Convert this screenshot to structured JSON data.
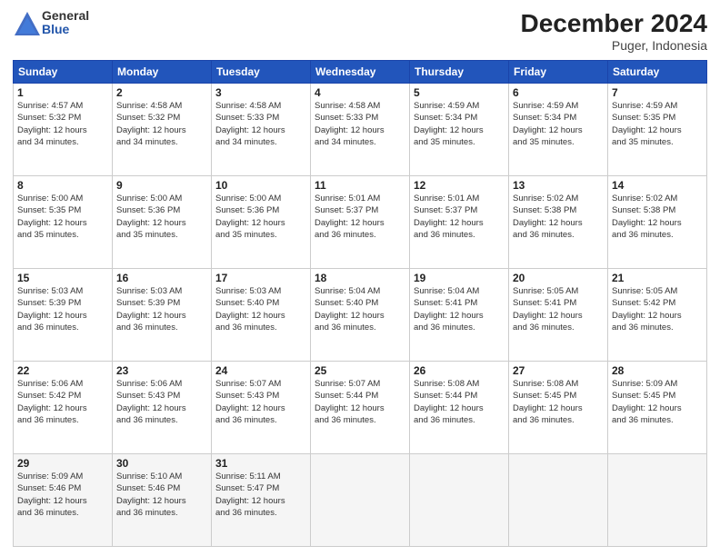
{
  "header": {
    "logo": {
      "general": "General",
      "blue": "Blue"
    },
    "title": "December 2024",
    "location": "Puger, Indonesia"
  },
  "weekdays": [
    "Sunday",
    "Monday",
    "Tuesday",
    "Wednesday",
    "Thursday",
    "Friday",
    "Saturday"
  ],
  "weeks": [
    [
      {
        "day": 1,
        "info": "Sunrise: 4:57 AM\nSunset: 5:32 PM\nDaylight: 12 hours\nand 34 minutes."
      },
      {
        "day": 2,
        "info": "Sunrise: 4:58 AM\nSunset: 5:32 PM\nDaylight: 12 hours\nand 34 minutes."
      },
      {
        "day": 3,
        "info": "Sunrise: 4:58 AM\nSunset: 5:33 PM\nDaylight: 12 hours\nand 34 minutes."
      },
      {
        "day": 4,
        "info": "Sunrise: 4:58 AM\nSunset: 5:33 PM\nDaylight: 12 hours\nand 34 minutes."
      },
      {
        "day": 5,
        "info": "Sunrise: 4:59 AM\nSunset: 5:34 PM\nDaylight: 12 hours\nand 35 minutes."
      },
      {
        "day": 6,
        "info": "Sunrise: 4:59 AM\nSunset: 5:34 PM\nDaylight: 12 hours\nand 35 minutes."
      },
      {
        "day": 7,
        "info": "Sunrise: 4:59 AM\nSunset: 5:35 PM\nDaylight: 12 hours\nand 35 minutes."
      }
    ],
    [
      {
        "day": 8,
        "info": "Sunrise: 5:00 AM\nSunset: 5:35 PM\nDaylight: 12 hours\nand 35 minutes."
      },
      {
        "day": 9,
        "info": "Sunrise: 5:00 AM\nSunset: 5:36 PM\nDaylight: 12 hours\nand 35 minutes."
      },
      {
        "day": 10,
        "info": "Sunrise: 5:00 AM\nSunset: 5:36 PM\nDaylight: 12 hours\nand 35 minutes."
      },
      {
        "day": 11,
        "info": "Sunrise: 5:01 AM\nSunset: 5:37 PM\nDaylight: 12 hours\nand 36 minutes."
      },
      {
        "day": 12,
        "info": "Sunrise: 5:01 AM\nSunset: 5:37 PM\nDaylight: 12 hours\nand 36 minutes."
      },
      {
        "day": 13,
        "info": "Sunrise: 5:02 AM\nSunset: 5:38 PM\nDaylight: 12 hours\nand 36 minutes."
      },
      {
        "day": 14,
        "info": "Sunrise: 5:02 AM\nSunset: 5:38 PM\nDaylight: 12 hours\nand 36 minutes."
      }
    ],
    [
      {
        "day": 15,
        "info": "Sunrise: 5:03 AM\nSunset: 5:39 PM\nDaylight: 12 hours\nand 36 minutes."
      },
      {
        "day": 16,
        "info": "Sunrise: 5:03 AM\nSunset: 5:39 PM\nDaylight: 12 hours\nand 36 minutes."
      },
      {
        "day": 17,
        "info": "Sunrise: 5:03 AM\nSunset: 5:40 PM\nDaylight: 12 hours\nand 36 minutes."
      },
      {
        "day": 18,
        "info": "Sunrise: 5:04 AM\nSunset: 5:40 PM\nDaylight: 12 hours\nand 36 minutes."
      },
      {
        "day": 19,
        "info": "Sunrise: 5:04 AM\nSunset: 5:41 PM\nDaylight: 12 hours\nand 36 minutes."
      },
      {
        "day": 20,
        "info": "Sunrise: 5:05 AM\nSunset: 5:41 PM\nDaylight: 12 hours\nand 36 minutes."
      },
      {
        "day": 21,
        "info": "Sunrise: 5:05 AM\nSunset: 5:42 PM\nDaylight: 12 hours\nand 36 minutes."
      }
    ],
    [
      {
        "day": 22,
        "info": "Sunrise: 5:06 AM\nSunset: 5:42 PM\nDaylight: 12 hours\nand 36 minutes."
      },
      {
        "day": 23,
        "info": "Sunrise: 5:06 AM\nSunset: 5:43 PM\nDaylight: 12 hours\nand 36 minutes."
      },
      {
        "day": 24,
        "info": "Sunrise: 5:07 AM\nSunset: 5:43 PM\nDaylight: 12 hours\nand 36 minutes."
      },
      {
        "day": 25,
        "info": "Sunrise: 5:07 AM\nSunset: 5:44 PM\nDaylight: 12 hours\nand 36 minutes."
      },
      {
        "day": 26,
        "info": "Sunrise: 5:08 AM\nSunset: 5:44 PM\nDaylight: 12 hours\nand 36 minutes."
      },
      {
        "day": 27,
        "info": "Sunrise: 5:08 AM\nSunset: 5:45 PM\nDaylight: 12 hours\nand 36 minutes."
      },
      {
        "day": 28,
        "info": "Sunrise: 5:09 AM\nSunset: 5:45 PM\nDaylight: 12 hours\nand 36 minutes."
      }
    ],
    [
      {
        "day": 29,
        "info": "Sunrise: 5:09 AM\nSunset: 5:46 PM\nDaylight: 12 hours\nand 36 minutes."
      },
      {
        "day": 30,
        "info": "Sunrise: 5:10 AM\nSunset: 5:46 PM\nDaylight: 12 hours\nand 36 minutes."
      },
      {
        "day": 31,
        "info": "Sunrise: 5:11 AM\nSunset: 5:47 PM\nDaylight: 12 hours\nand 36 minutes."
      },
      {
        "day": null,
        "info": ""
      },
      {
        "day": null,
        "info": ""
      },
      {
        "day": null,
        "info": ""
      },
      {
        "day": null,
        "info": ""
      }
    ]
  ]
}
